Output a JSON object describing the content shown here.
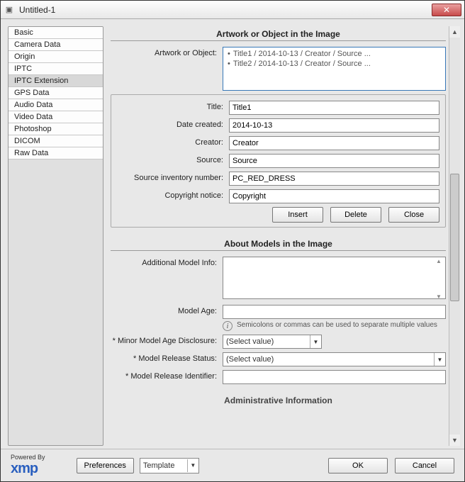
{
  "window": {
    "title": "Untitled-1"
  },
  "sidebar": {
    "items": [
      {
        "label": "Basic"
      },
      {
        "label": "Camera Data"
      },
      {
        "label": "Origin"
      },
      {
        "label": "IPTC"
      },
      {
        "label": "IPTC Extension",
        "selected": true
      },
      {
        "label": "GPS Data"
      },
      {
        "label": "Audio Data"
      },
      {
        "label": "Video Data"
      },
      {
        "label": "Photoshop"
      },
      {
        "label": "DICOM"
      },
      {
        "label": "Raw Data"
      }
    ]
  },
  "section_artwork": {
    "title": "Artwork or Object in the Image",
    "list_label": "Artwork or Object:",
    "items": [
      "Title1 / 2014-10-13 / Creator / Source ...",
      "Title2 / 2014-10-13 / Creator / Source ..."
    ],
    "fields": {
      "title_label": "Title:",
      "title_value": "Title1",
      "date_label": "Date created:",
      "date_value": "2014-10-13",
      "creator_label": "Creator:",
      "creator_value": "Creator",
      "source_label": "Source:",
      "source_value": "Source",
      "inventory_label": "Source inventory number:",
      "inventory_value": "PC_RED_DRESS",
      "copyright_label": "Copyright notice:",
      "copyright_value": "Copyright"
    },
    "buttons": {
      "insert": "Insert",
      "delete": "Delete",
      "close": "Close"
    }
  },
  "section_models": {
    "title": "About Models in the Image",
    "add_info_label": "Additional Model Info:",
    "add_info_value": "",
    "age_label": "Model Age:",
    "age_value": "",
    "age_hint": "Semicolons or commas can be used to separate multiple values",
    "minor_label": "* Minor Model Age Disclosure:",
    "minor_value": "(Select value)",
    "release_label": "* Model Release Status:",
    "release_value": "(Select value)",
    "release_id_label": "* Model Release Identifier:",
    "release_id_value": ""
  },
  "section_admin": {
    "title": "Administrative Information"
  },
  "footer": {
    "powered": "Powered By",
    "logo": "xmp",
    "preferences": "Preferences",
    "template": "Template",
    "ok": "OK",
    "cancel": "Cancel"
  }
}
